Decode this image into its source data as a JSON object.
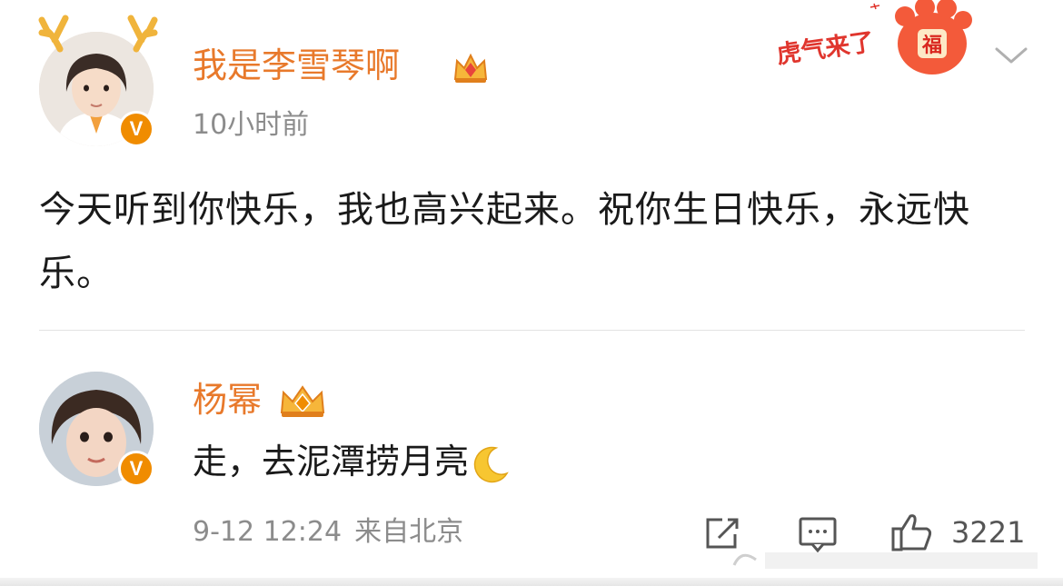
{
  "post": {
    "author": "我是李雪琴啊",
    "time": "10小时前",
    "text": "今天听到你快乐，我也高兴起来。祝你生日快乐，永远快乐。",
    "festival_badge": "虎气来了",
    "festival_badge_char": "福"
  },
  "comment": {
    "author": "杨幂",
    "text": "走，去泥潭捞月亮",
    "date": "9-12 12:24",
    "source": "来自北京",
    "likes": "3221"
  },
  "colors": {
    "name": "#e8792b",
    "verified_badge": "#f08c00",
    "meta_text": "#8c8c8c"
  },
  "icons": [
    "chevron-down-icon",
    "verified-v-icon",
    "crown-icon",
    "moon-emoji-icon",
    "share-icon",
    "comment-icon",
    "like-icon"
  ]
}
